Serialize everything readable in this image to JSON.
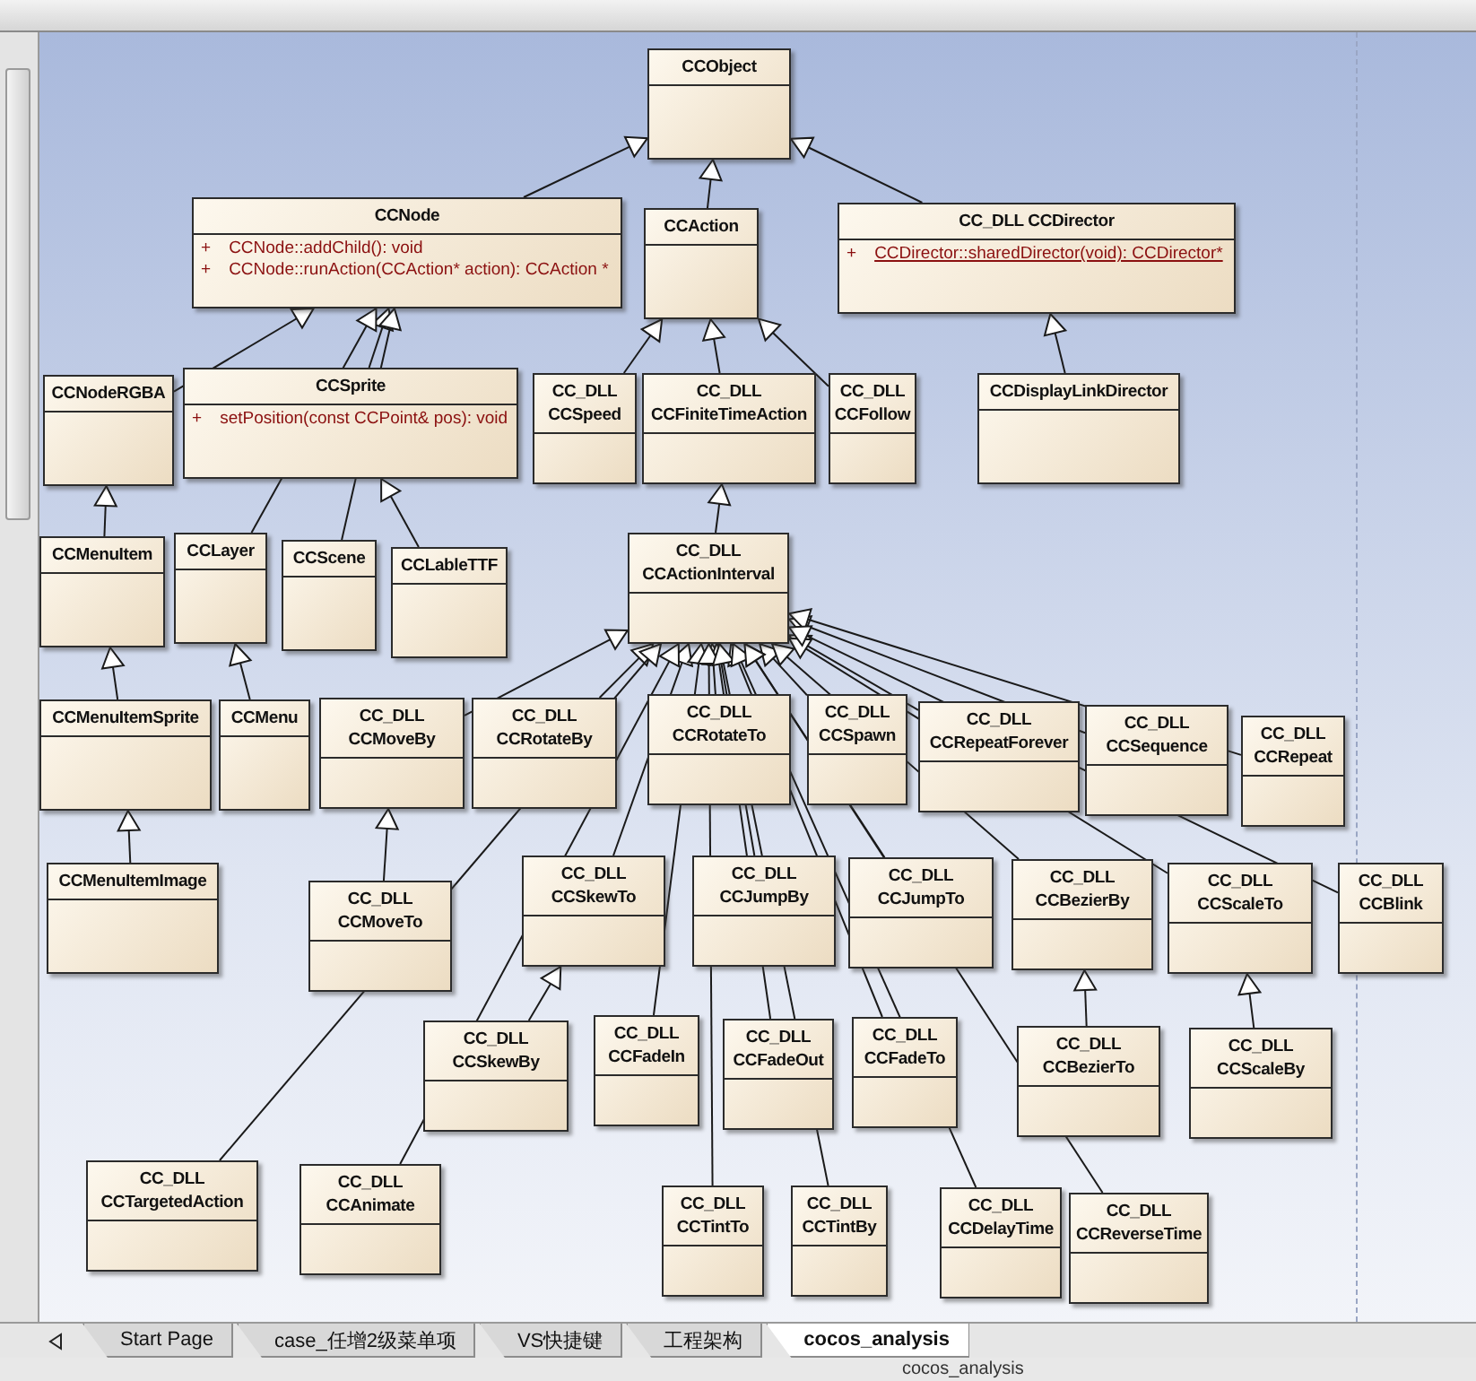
{
  "diagram": {
    "root": {
      "name": "CCObject",
      "children": [
        {
          "name": "CCNode",
          "methods": [
            {
              "visibility": "+",
              "signature": "CCNode::addChild():  void",
              "static": false
            },
            {
              "visibility": "+",
              "signature": "CCNode::runAction(CCAction* action):  CCAction *",
              "static": false
            }
          ],
          "children": [
            {
              "name": "CCNodeRGBA",
              "children": [
                {
                  "name": "CCMenuItem",
                  "children": [
                    {
                      "name": "CCMenuItemSprite",
                      "children": [
                        {
                          "name": "CCMenuItemImage"
                        }
                      ]
                    }
                  ]
                }
              ]
            },
            {
              "name": "CCSprite",
              "methods": [
                {
                  "visibility": "+",
                  "signature": "setPosition(const CCPoint& pos):  void",
                  "static": false
                }
              ],
              "children": [
                {
                  "name": "CCLableTTF"
                }
              ]
            },
            {
              "name": "CCLayer",
              "children": [
                {
                  "name": "CCMenu"
                }
              ]
            },
            {
              "name": "CCScene"
            }
          ]
        },
        {
          "name": "CCAction",
          "children": [
            {
              "name": "CC_DLL CCSpeed"
            },
            {
              "name": "CC_DLL CCFiniteTimeAction",
              "children": [
                {
                  "name": "CC_DLL CCActionInterval",
                  "children": [
                    {
                      "name": "CC_DLL CCMoveBy",
                      "children": [
                        {
                          "name": "CC_DLL CCMoveTo"
                        }
                      ]
                    },
                    {
                      "name": "CC_DLL CCRotateBy"
                    },
                    {
                      "name": "CC_DLL CCRotateTo"
                    },
                    {
                      "name": "CC_DLL CCSpawn"
                    },
                    {
                      "name": "CC_DLL CCRepeatForever"
                    },
                    {
                      "name": "CC_DLL CCSequence"
                    },
                    {
                      "name": "CC_DLL CCRepeat"
                    },
                    {
                      "name": "CC_DLL CCSkewTo",
                      "children": [
                        {
                          "name": "CC_DLL CCSkewBy"
                        }
                      ]
                    },
                    {
                      "name": "CC_DLL CCJumpBy"
                    },
                    {
                      "name": "CC_DLL CCJumpTo"
                    },
                    {
                      "name": "CC_DLL CCBezierBy",
                      "children": [
                        {
                          "name": "CC_DLL CCBezierTo"
                        }
                      ]
                    },
                    {
                      "name": "CC_DLL CCScaleTo",
                      "children": [
                        {
                          "name": "CC_DLL CCScaleBy"
                        }
                      ]
                    },
                    {
                      "name": "CC_DLL CCBlink"
                    },
                    {
                      "name": "CC_DLL CCFadeIn"
                    },
                    {
                      "name": "CC_DLL CCFadeOut"
                    },
                    {
                      "name": "CC_DLL CCFadeTo"
                    },
                    {
                      "name": "CC_DLL CCTargetedAction"
                    },
                    {
                      "name": "CC_DLL CCAnimate"
                    },
                    {
                      "name": "CC_DLL CCTintTo"
                    },
                    {
                      "name": "CC_DLL CCTintBy"
                    },
                    {
                      "name": "CC_DLL CCDelayTime"
                    },
                    {
                      "name": "CC_DLL CCReverseTime"
                    }
                  ]
                }
              ]
            },
            {
              "name": "CC_DLL CCFollow"
            }
          ]
        },
        {
          "name": "CC_DLL CCDirector",
          "methods": [
            {
              "visibility": "+",
              "signature": "CCDirector::sharedDirector(void):  CCDirector*",
              "static": true
            }
          ],
          "children": [
            {
              "name": "CCDisplayLinkDirector"
            }
          ]
        }
      ]
    }
  },
  "tabs": [
    {
      "label": "Start Page",
      "selected": false
    },
    {
      "label": "case_任增2级菜单项",
      "selected": false
    },
    {
      "label": "VS快捷键",
      "selected": false
    },
    {
      "label": "工程架构",
      "selected": false
    },
    {
      "label": "cocos_analysis",
      "selected": true
    }
  ],
  "status_bar": "cocos_analysis"
}
